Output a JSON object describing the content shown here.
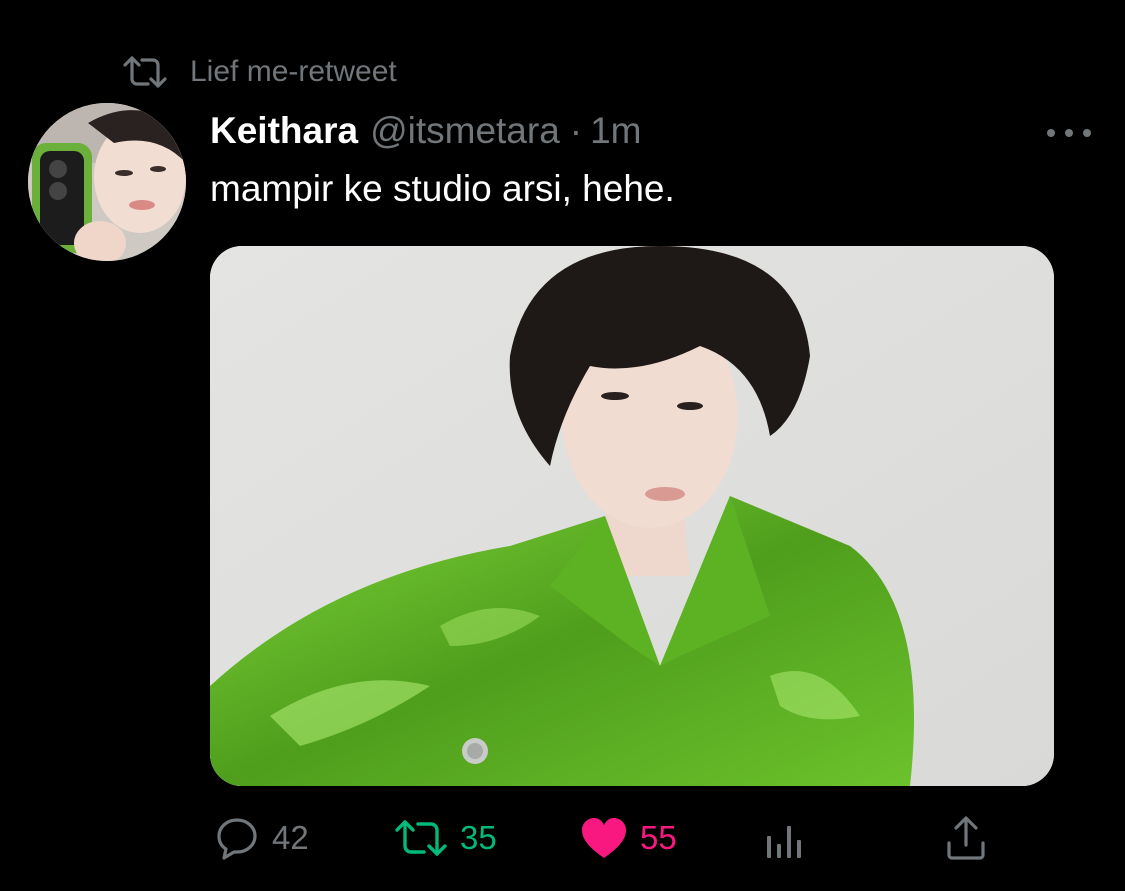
{
  "retweet_context": {
    "icon": "retweet-icon",
    "text": "Lief me-retweet"
  },
  "tweet": {
    "display_name": "Keithara",
    "handle": "@itsmetara",
    "separator": "·",
    "time": "1m",
    "text": "mampir ke studio arsi, hehe.",
    "more_icon": "more-horizontal-icon",
    "media": {
      "alt": "",
      "icon": "photo"
    }
  },
  "actions": {
    "reply": {
      "icon": "reply-icon",
      "count": "42"
    },
    "retweet": {
      "icon": "retweet-icon",
      "count": "35"
    },
    "like": {
      "icon": "heart-filled-icon",
      "count": "55"
    },
    "views": {
      "icon": "analytics-icon"
    },
    "share": {
      "icon": "share-icon"
    }
  },
  "colors": {
    "background": "#000000",
    "text_primary": "#ffffff",
    "text_secondary": "#71767b",
    "retweet_active": "#00ba7c",
    "like_active": "#f91880"
  }
}
